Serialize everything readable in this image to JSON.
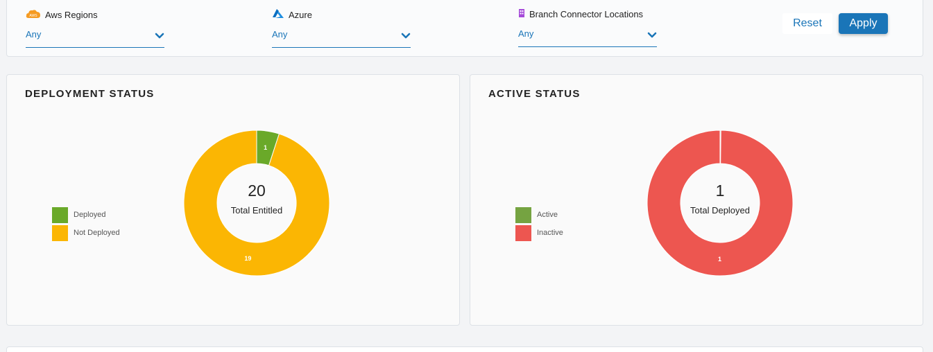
{
  "filters": [
    {
      "label": "Aws Regions",
      "value": "Any",
      "icon": "aws-icon"
    },
    {
      "label": "Azure",
      "value": "Any",
      "icon": "azure-icon"
    },
    {
      "label": "Branch Connector Locations",
      "value": "Any",
      "icon": "building-icon"
    }
  ],
  "aws_badge": "AWS",
  "buttons": {
    "reset": "Reset",
    "apply": "Apply"
  },
  "colors": {
    "accent": "#1a75b8",
    "deployed": "#6aa929",
    "not_deployed": "#fbb603",
    "active": "#75a341",
    "inactive": "#ed5650"
  },
  "deployment": {
    "title": "DEPLOYMENT STATUS",
    "center_value": "20",
    "center_label": "Total Entitled"
  },
  "active": {
    "title": "ACTIVE STATUS",
    "center_value": "1",
    "center_label": "Total Deployed"
  },
  "chart_data": [
    {
      "type": "pie",
      "title": "DEPLOYMENT STATUS",
      "categories": [
        "Deployed",
        "Not Deployed"
      ],
      "values": [
        1,
        19
      ],
      "colors": [
        "#6aa929",
        "#fbb603"
      ],
      "legend": "left",
      "total": 20
    },
    {
      "type": "pie",
      "title": "ACTIVE STATUS",
      "categories": [
        "Active",
        "Inactive"
      ],
      "values": [
        0,
        1
      ],
      "colors": [
        "#75a341",
        "#ed5650"
      ],
      "legend": "left",
      "total": 1,
      "slice_labels": [
        "",
        "1"
      ]
    }
  ]
}
